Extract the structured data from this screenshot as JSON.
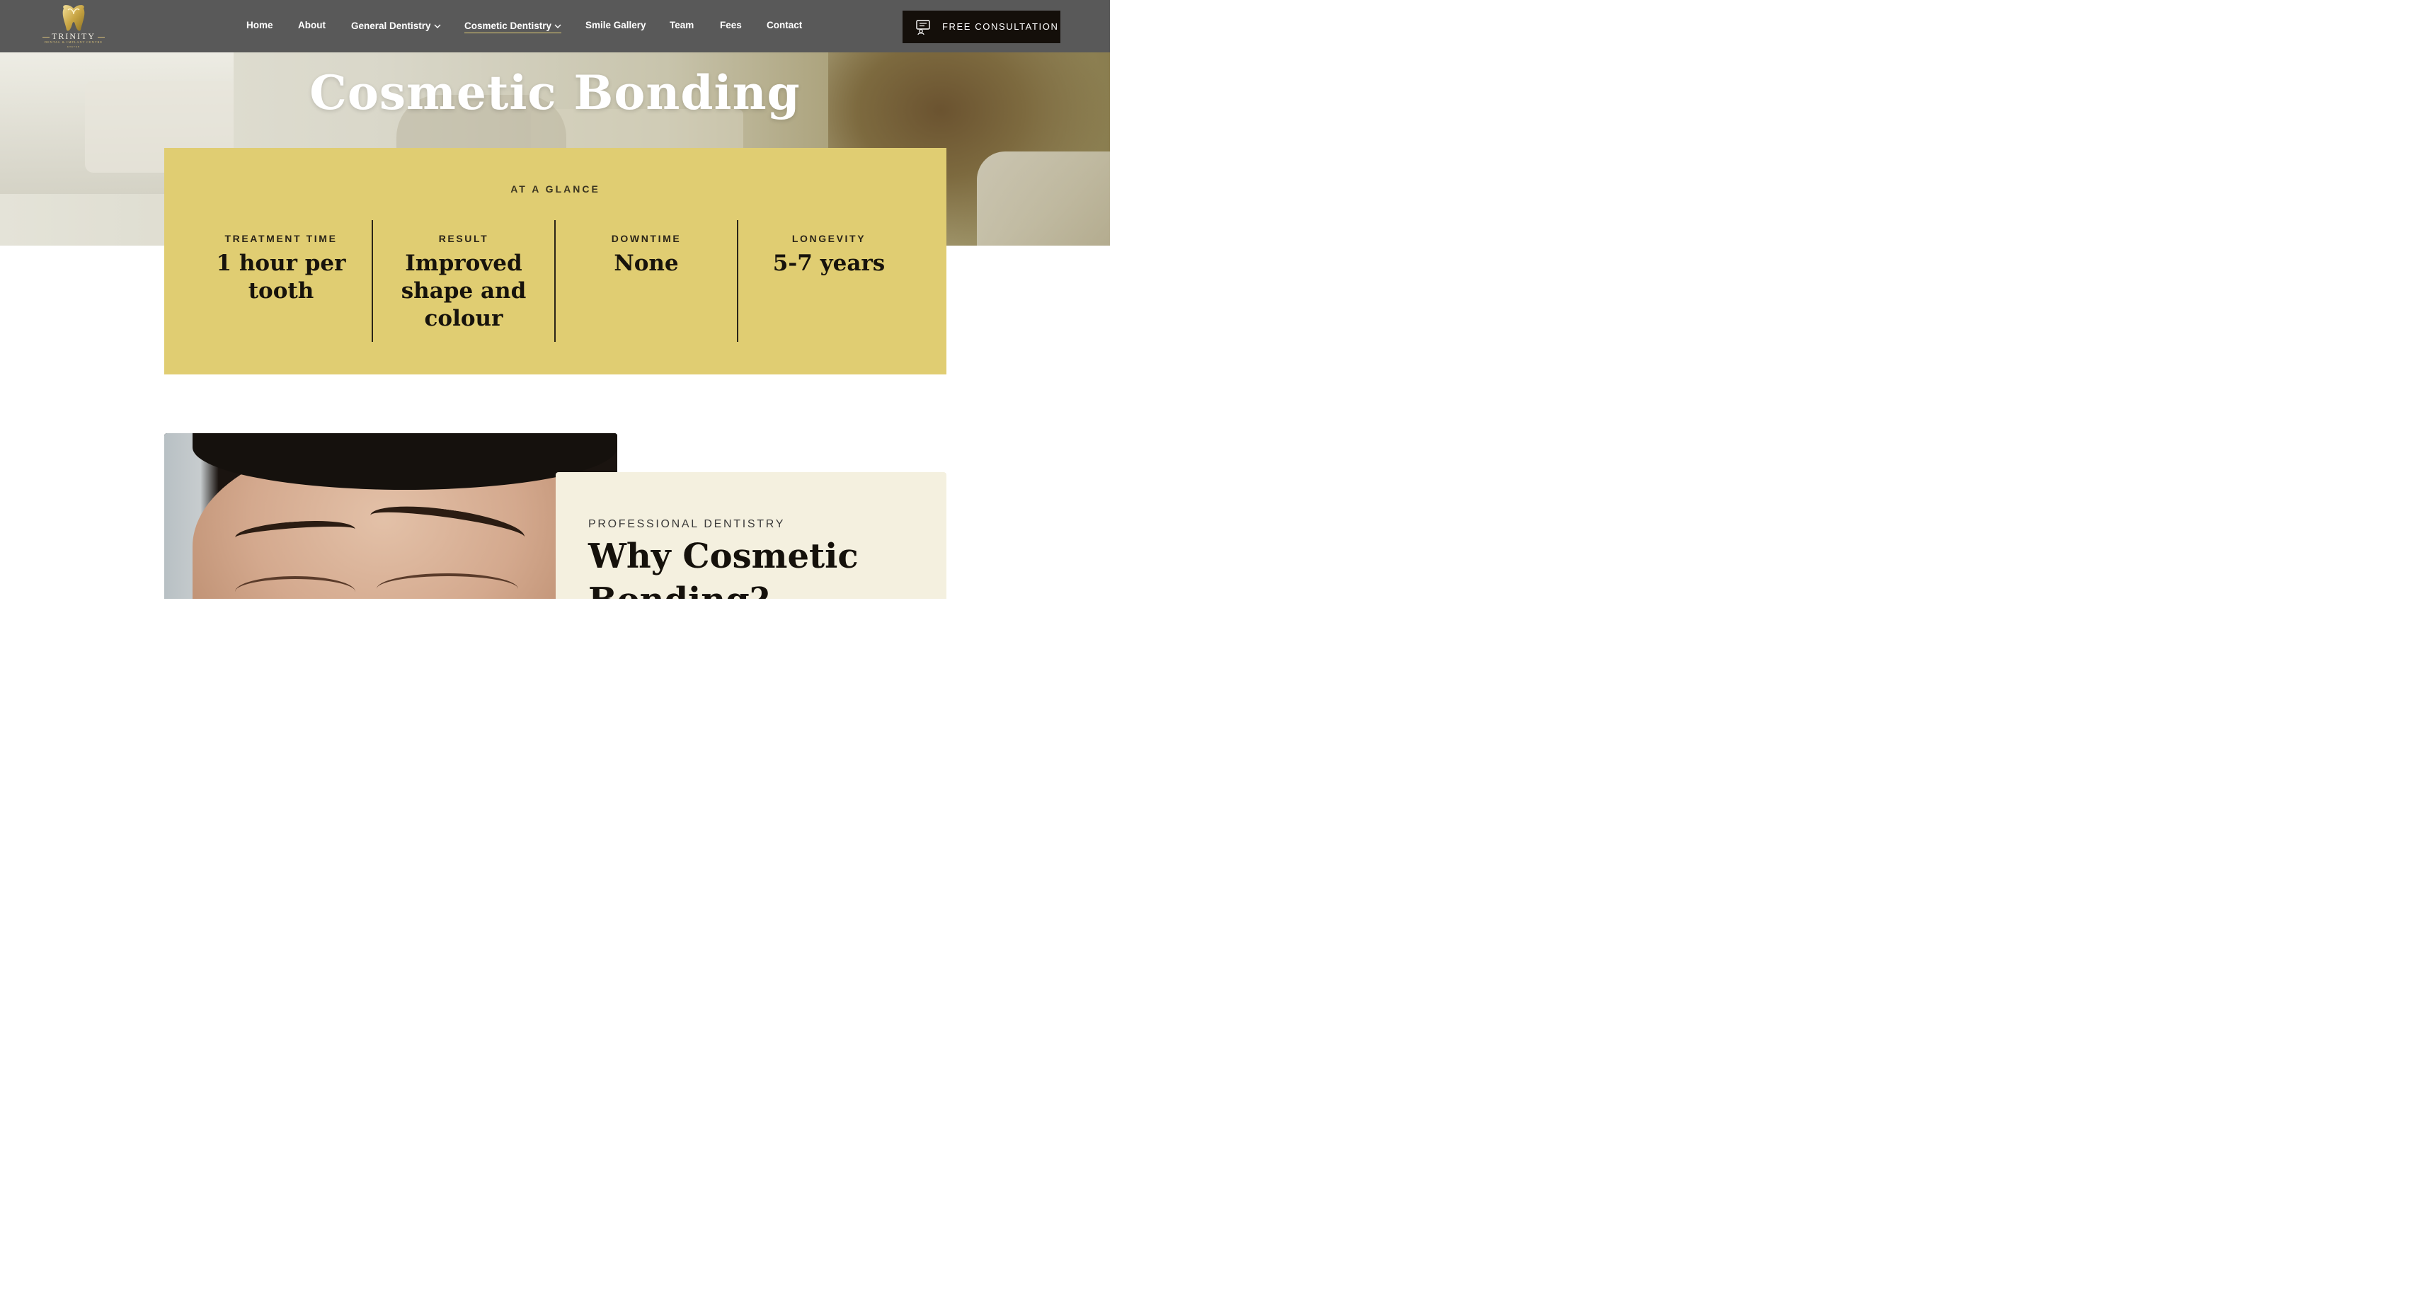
{
  "logo": {
    "name": "TRINITY",
    "subtitle": "DENTAL & IMPLANT CENTRE",
    "tagline": "EXETER"
  },
  "nav": {
    "items": [
      {
        "label": "Home"
      },
      {
        "label": "About"
      },
      {
        "label": "General Dentistry"
      },
      {
        "label": "Cosmetic Dentistry"
      },
      {
        "label": "Smile Gallery"
      },
      {
        "label": "Team"
      },
      {
        "label": "Fees"
      },
      {
        "label": "Contact"
      }
    ],
    "active": "Cosmetic Dentistry",
    "cta_label": "FREE CONSULTATION"
  },
  "hero": {
    "title": "Cosmetic Bonding"
  },
  "glance": {
    "title": "AT A GLANCE",
    "items": [
      {
        "label": "TREATMENT TIME",
        "value": "1 hour per tooth"
      },
      {
        "label": "RESULT",
        "value": "Improved shape and colour"
      },
      {
        "label": "DOWNTIME",
        "value": "None"
      },
      {
        "label": "LONGEVITY",
        "value": "5-7 years"
      }
    ]
  },
  "intro": {
    "eyebrow": "PROFESSIONAL DENTISTRY",
    "heading": "Why Cosmetic Bonding?"
  },
  "colors": {
    "nav_bg": "#595959",
    "accent_gold": "#e0cd72",
    "cta_bg": "#140f0a",
    "card_bg": "#f4f0df"
  },
  "icons": {
    "cta": "consultation-icon",
    "dropdown": "chevron-down-icon"
  }
}
